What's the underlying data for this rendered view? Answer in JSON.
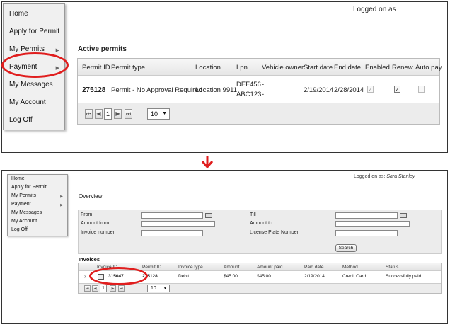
{
  "top": {
    "menu": [
      {
        "label": "Home",
        "has_submenu": false
      },
      {
        "label": "Apply for Permit",
        "has_submenu": false
      },
      {
        "label": "My Permits",
        "has_submenu": true
      },
      {
        "label": "Payment",
        "has_submenu": true
      },
      {
        "label": "My Messages",
        "has_submenu": false
      },
      {
        "label": "My Account",
        "has_submenu": false
      },
      {
        "label": "Log Off",
        "has_submenu": false
      }
    ],
    "logged_on": "Logged on as",
    "section_title": "Active permits",
    "columns": [
      "Permit ID",
      "Permit type",
      "Location",
      "Lpn",
      "Vehicle owner",
      "Start date",
      "End date",
      "Enabled",
      "Renew",
      "Auto pay"
    ],
    "row": {
      "permit_id": "275128",
      "permit_type": "Permit - No Approval Required",
      "location": "Location 9911",
      "lpn_1": "DEF456",
      "lpn_2": "ABC123",
      "owner_1": "-",
      "owner_2": "-",
      "start_date": "2/19/2014",
      "end_date": "2/28/2014",
      "enabled": true,
      "renew": true,
      "auto_pay": false
    },
    "pager": {
      "first": "⏮",
      "prev": "◀",
      "page": "1",
      "next": "▶",
      "last": "⏭",
      "page_size": "10",
      "caret": "▼"
    }
  },
  "bottom": {
    "menu": [
      {
        "label": "Home",
        "has_submenu": false
      },
      {
        "label": "Apply for Permit",
        "has_submenu": false
      },
      {
        "label": "My Permits",
        "has_submenu": true
      },
      {
        "label": "Payment",
        "has_submenu": true
      },
      {
        "label": "My Messages",
        "has_submenu": false
      },
      {
        "label": "My Account",
        "has_submenu": false
      },
      {
        "label": "Log Off",
        "has_submenu": false
      }
    ],
    "logged_on_prefix": "Logged on as: ",
    "user_name": "Sara Stanley",
    "page_title": "Overview",
    "filters": {
      "from": "From",
      "amount_from": "Amount from",
      "invoice_number": "Invoice number",
      "till": "Till",
      "amount_to": "Amount to",
      "license_plate_number": "License Plate Number",
      "search_button": "Search"
    },
    "invoices_title": "Invoices",
    "columns": [
      "Invoice ID",
      "Permit ID",
      "Invoice type",
      "Amount",
      "Amount paid",
      "Paid date",
      "Method",
      "Status"
    ],
    "row": {
      "expand": "›",
      "invoice_id": "315047",
      "permit_id": "275128",
      "invoice_type": "Debit",
      "amount": "$45.00",
      "amount_paid": "$45.00",
      "paid_date": "2/19/2014",
      "method": "Credit Card",
      "status": "Successfully paid"
    },
    "pager": {
      "first": "⏮",
      "prev": "◀",
      "page": "1",
      "next": "▶",
      "last": "⏭",
      "page_size": "10",
      "caret": "▼"
    }
  },
  "colors": {
    "highlight_ring": "#e01e1e",
    "flow_arrow": "#e01e1e"
  }
}
